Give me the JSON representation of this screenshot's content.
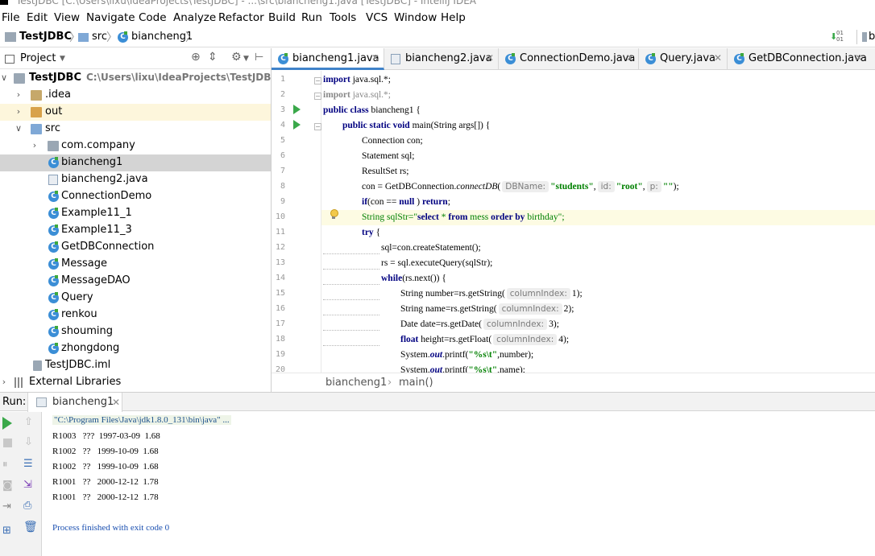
{
  "window": {
    "title": "TestJDBC [C:\\Users\\lixu\\IdeaProjects\\TestJDBC] - ...\\src\\biancheng1.java [TestJDBC] - IntelliJ IDEA"
  },
  "menu": [
    "File",
    "Edit",
    "View",
    "Navigate",
    "Code",
    "Analyze",
    "Refactor",
    "Build",
    "Run",
    "Tools",
    "VCS",
    "Window",
    "Help"
  ],
  "breadcrumb": [
    "TestJDBC",
    "src",
    "biancheng1"
  ],
  "nav_right_label": "bi",
  "project_panel": {
    "title": "Project",
    "tree": [
      {
        "label": "TestJDBC",
        "path": "C:\\Users\\lixu\\IdeaProjects\\TestJDBC",
        "icon": "folder-gray-icon",
        "arrow": "down",
        "bold": true
      },
      {
        "label": ".idea",
        "icon": "folder-icon",
        "arrow": "right"
      },
      {
        "label": "out",
        "icon": "folder-orange-icon",
        "arrow": "right"
      },
      {
        "label": "src",
        "icon": "folder-blue-icon",
        "arrow": "down"
      },
      {
        "label": "com.company",
        "icon": "package-icon",
        "arrow": "right"
      },
      {
        "label": "biancheng1",
        "icon": "class-icon",
        "selected": true
      },
      {
        "label": "biancheng2.java",
        "icon": "java-file-icon"
      },
      {
        "label": "ConnectionDemo",
        "icon": "class-icon"
      },
      {
        "label": "Example11_1",
        "icon": "class-icon"
      },
      {
        "label": "Example11_3",
        "icon": "class-icon"
      },
      {
        "label": "GetDBConnection",
        "icon": "class-icon"
      },
      {
        "label": "Message",
        "icon": "class-icon"
      },
      {
        "label": "MessageDAO",
        "icon": "class-icon"
      },
      {
        "label": "Query",
        "icon": "class-icon"
      },
      {
        "label": "renkou",
        "icon": "class-icon"
      },
      {
        "label": "shouming",
        "icon": "class-icon"
      },
      {
        "label": "zhongdong",
        "icon": "class-icon"
      },
      {
        "label": "TestJDBC.iml",
        "icon": "iml-file-icon"
      },
      {
        "label": "External Libraries",
        "icon": "library-icon",
        "arrow": "right"
      }
    ]
  },
  "tabs": [
    {
      "label": "biancheng1.java",
      "active": true
    },
    {
      "label": "biancheng2.java"
    },
    {
      "label": "ConnectionDemo.java"
    },
    {
      "label": "Query.java"
    },
    {
      "label": "GetDBConnection.java"
    }
  ],
  "editor": {
    "line_numbers": [
      "1",
      "2",
      "3",
      "4",
      "5",
      "6",
      "7",
      "8",
      "9",
      "10",
      "11",
      "12",
      "13",
      "14",
      "15",
      "16",
      "17",
      "18",
      "19",
      "20"
    ],
    "hints": {
      "dbname": "DBName:",
      "id": "id:",
      "p": "p:",
      "column_index": "columnIndex:"
    },
    "code": {
      "l1": [
        "import",
        " java.sql.*;"
      ],
      "l2": [
        "import",
        " java.sql.*;"
      ],
      "l3": [
        "public class",
        " biancheng1 {"
      ],
      "l4": [
        "public static void",
        " main(String args[]) {"
      ],
      "l5": "Connection con;",
      "l6": "Statement sql;",
      "l7": "ResultSet rs;",
      "l8": [
        "con = GetDBConnection.",
        "connectDB",
        "(",
        "\"students\"",
        ",",
        "\"root\"",
        ",",
        "\"\"",
        ");"
      ],
      "l9": [
        "if",
        "(con == ",
        "null",
        " ) ",
        "return",
        ";"
      ],
      "l10": [
        "String sqlStr=\"",
        "select",
        " * ",
        "from",
        " mess ",
        "order by",
        " birthday\";"
      ],
      "l11": [
        "try",
        " {"
      ],
      "l12": "sql=con.createStatement();",
      "l13": "rs = sql.executeQuery(sqlStr);",
      "l14": [
        "while",
        "(rs.next()) {"
      ],
      "l15": [
        "String number=rs.getString(",
        "1);"
      ],
      "l16": [
        "String name=rs.getString(",
        "2);"
      ],
      "l17": [
        "Date date=rs.getDate(",
        "3);"
      ],
      "l18": [
        "float",
        " height=rs.getFloat(",
        "4);"
      ],
      "l19": [
        "System.",
        "out",
        ".printf(",
        "\"%s\\t\"",
        ",number);"
      ],
      "l20": [
        "System.",
        "out",
        ".printf(",
        "\"%s\\t\"",
        ",name);"
      ]
    }
  },
  "editor_breadcrumb": [
    "biancheng1",
    "main()"
  ],
  "run": {
    "label": "Run:",
    "tab": "biancheng1",
    "console": [
      "\"C:\\Program Files\\Java\\jdk1.8.0_131\\bin\\java\" ...",
      "R1003   ???  1997-03-09  1.68",
      "R1002   ??   1999-10-09  1.68",
      "R1002   ??   1999-10-09  1.68",
      "R1001   ??   2000-12-12  1.78",
      "R1001   ??   2000-12-12  1.78",
      "Process finished with exit code 0"
    ]
  },
  "colors": {
    "keyword": "#000080",
    "string": "#008000",
    "selection": "#d4d4d4",
    "tab_accent": "#4083c9",
    "run_green": "#3aa84a"
  }
}
